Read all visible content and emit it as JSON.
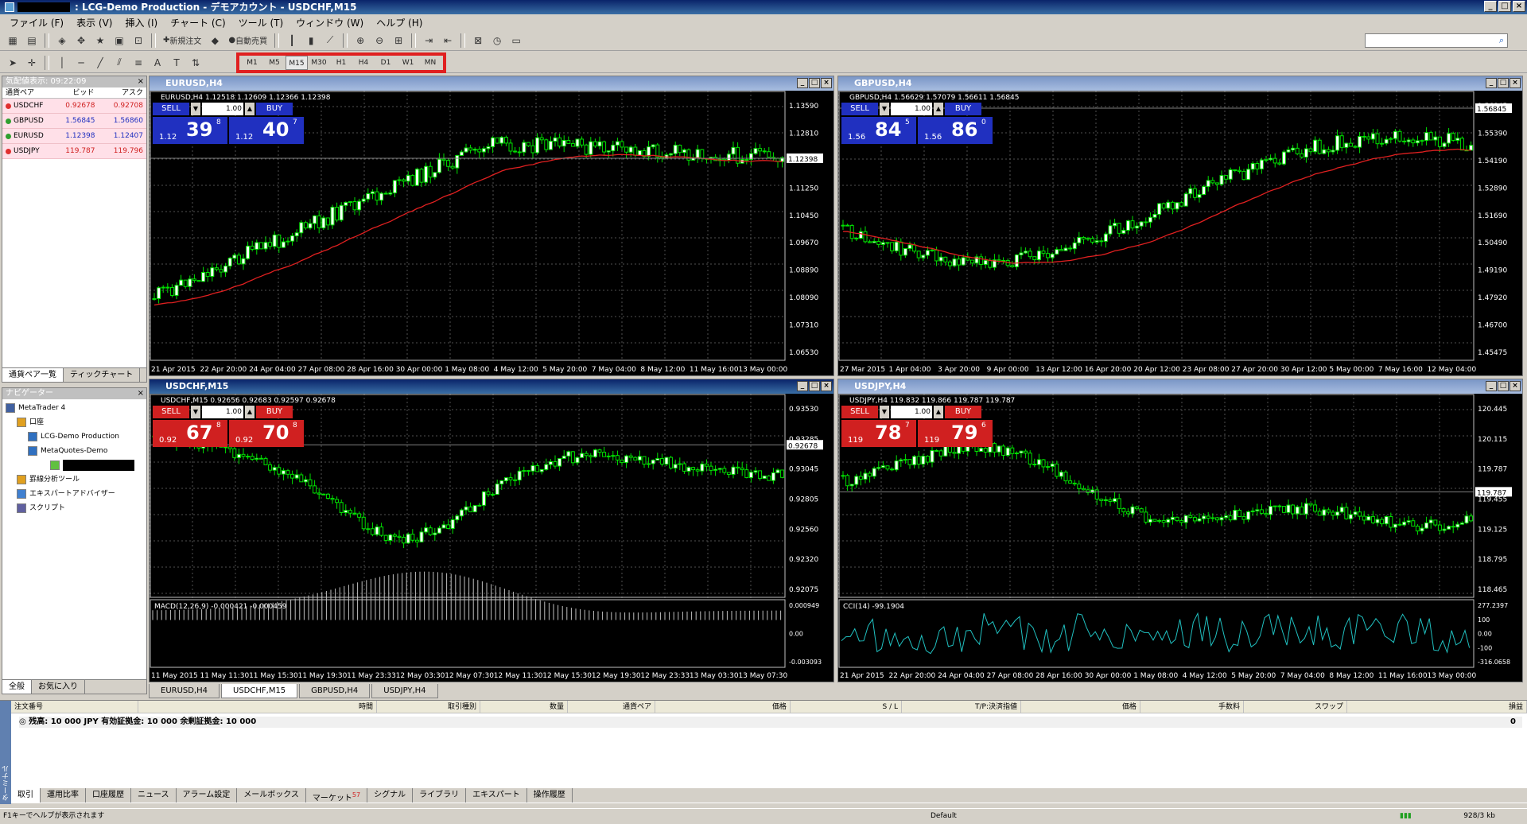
{
  "window": {
    "title": ": LCG-Demo Production - デモアカウント - USDCHF,M15"
  },
  "menu": [
    "ファイル (F)",
    "表示 (V)",
    "挿入 (I)",
    "チャート (C)",
    "ツール (T)",
    "ウィンドウ (W)",
    "ヘルプ (H)"
  ],
  "toolbar": {
    "new_order": "新規注文",
    "auto_trade": "自動売買"
  },
  "timeframes": [
    "M1",
    "M5",
    "M15",
    "M30",
    "H1",
    "H4",
    "D1",
    "W1",
    "MN"
  ],
  "active_timeframe": "M15",
  "market_watch": {
    "title": "気配値表示: 09:22:09",
    "headers": [
      "通貨ペア",
      "ビッド",
      "アスク"
    ],
    "rows": [
      {
        "symbol": "USDCHF",
        "bid": "0.92678",
        "ask": "0.92708",
        "color": "#e03030"
      },
      {
        "symbol": "GBPUSD",
        "bid": "1.56845",
        "ask": "1.56860",
        "color": "#30a030"
      },
      {
        "symbol": "EURUSD",
        "bid": "1.12398",
        "ask": "1.12407",
        "color": "#30a030"
      },
      {
        "symbol": "USDJPY",
        "bid": "119.787",
        "ask": "119.796",
        "color": "#e03030"
      }
    ],
    "tabs": [
      "通貨ペア一覧",
      "ティックチャート"
    ]
  },
  "navigator": {
    "title": "ナビゲーター",
    "items": [
      {
        "label": "MetaTrader 4",
        "level": 0
      },
      {
        "label": "口座",
        "level": 1
      },
      {
        "label": "LCG-Demo Production",
        "level": 2
      },
      {
        "label": "MetaQuotes-Demo",
        "level": 2
      },
      {
        "label": "罫線分析ツール",
        "level": 1
      },
      {
        "label": "エキスパートアドバイザー",
        "level": 1
      },
      {
        "label": "スクリプト",
        "level": 1
      }
    ],
    "tabs": [
      "全般",
      "お気に入り"
    ]
  },
  "charts": [
    {
      "id": "eurusd",
      "title": "EURUSD,H4",
      "header": "EURUSD,H4  1.12518 1.12609 1.12366 1.12398",
      "sell_big": "39",
      "sell_sup": "8",
      "sell_pre": "1.12",
      "buy_big": "40",
      "buy_sup": "7",
      "buy_pre": "1.12",
      "lot": "1.00",
      "panel_color": "#2030c0",
      "prices": [
        "1.13590",
        "1.12810",
        "1.12030",
        "1.11250",
        "1.10450",
        "1.09670",
        "1.08890",
        "1.08090",
        "1.07310",
        "1.06530"
      ],
      "current": "1.12398",
      "dates": [
        "21 Apr 2015",
        "22 Apr 20:00",
        "24 Apr 04:00",
        "27 Apr 08:00",
        "28 Apr 16:00",
        "30 Apr 00:00",
        "1 May 08:00",
        "4 May 12:00",
        "5 May 20:00",
        "7 May 04:00",
        "8 May 12:00",
        "11 May 16:00",
        "13 May 00:00"
      ],
      "active": false,
      "sub": null
    },
    {
      "id": "gbpusd",
      "title": "GBPUSD,H4",
      "header": "GBPUSD,H4  1.56629 1.57079 1.56611 1.56845",
      "sell_big": "84",
      "sell_sup": "5",
      "sell_pre": "1.56",
      "buy_big": "86",
      "buy_sup": "0",
      "buy_pre": "1.56",
      "lot": "1.00",
      "panel_color": "#2030c0",
      "prices": [
        "1.56845",
        "1.55390",
        "1.54190",
        "1.52890",
        "1.51690",
        "1.50490",
        "1.49190",
        "1.47920",
        "1.46700",
        "1.45475"
      ],
      "current": "1.56845",
      "dates": [
        "27 Mar 2015",
        "1 Apr 04:00",
        "3 Apr 20:00",
        "9 Apr 00:00",
        "13 Apr 12:00",
        "16 Apr 20:00",
        "20 Apr 12:00",
        "23 Apr 08:00",
        "27 Apr 20:00",
        "30 Apr 12:00",
        "5 May 00:00",
        "7 May 16:00",
        "12 May 04:00"
      ],
      "active": false,
      "sub": null
    },
    {
      "id": "usdchf",
      "title": "USDCHF,M15",
      "header": "USDCHF,M15  0.92656 0.92683 0.92597 0.92678",
      "sell_big": "67",
      "sell_sup": "8",
      "sell_pre": "0.92",
      "buy_big": "70",
      "buy_sup": "8",
      "buy_pre": "0.92",
      "lot": "1.00",
      "panel_color": "#d02020",
      "prices": [
        "0.93530",
        "0.93285",
        "0.93045",
        "0.92805",
        "0.92560",
        "0.92320",
        "0.92075"
      ],
      "current": "0.92678",
      "dates": [
        "11 May 2015",
        "11 May 11:30",
        "11 May 15:30",
        "11 May 19:30",
        "11 May 23:33",
        "12 May 03:30",
        "12 May 07:30",
        "12 May 11:30",
        "12 May 15:30",
        "12 May 19:30",
        "12 May 23:33",
        "13 May 03:30",
        "13 May 07:30"
      ],
      "active": true,
      "sub": {
        "label": "MACD(12,26,9) -0.000421 -0.000459",
        "ticks": [
          "0.000949",
          "0.00",
          "-0.003093"
        ]
      }
    },
    {
      "id": "usdjpy",
      "title": "USDJPY,H4",
      "header": "USDJPY,H4  119.832 119.866 119.787 119.787",
      "sell_big": "78",
      "sell_sup": "7",
      "sell_pre": "119",
      "buy_big": "79",
      "buy_sup": "6",
      "buy_pre": "119",
      "lot": "1.00",
      "panel_color": "#d02020",
      "prices": [
        "120.445",
        "120.115",
        "119.787",
        "119.455",
        "119.125",
        "118.795",
        "118.465"
      ],
      "current": "119.787",
      "dates": [
        "21 Apr 2015",
        "22 Apr 20:00",
        "24 Apr 04:00",
        "27 Apr 08:00",
        "28 Apr 16:00",
        "30 Apr 00:00",
        "1 May 08:00",
        "4 May 12:00",
        "5 May 20:00",
        "7 May 04:00",
        "8 May 12:00",
        "11 May 16:00",
        "13 May 00:00"
      ],
      "active": false,
      "sub": {
        "label": "CCI(14) -99.1904",
        "ticks": [
          "277.2397",
          "100",
          "0.00",
          "-100",
          "-316.0658"
        ]
      }
    }
  ],
  "chart_tabs": [
    "EURUSD,H4",
    "USDCHF,M15",
    "GBPUSD,H4",
    "USDJPY,H4"
  ],
  "active_chart_tab": "USDCHF,M15",
  "terminal": {
    "columns": [
      "注文番号",
      "時間",
      "取引種別",
      "数量",
      "通貨ペア",
      "価格",
      "S / L",
      "T/P:決済指値",
      "価格",
      "手数料",
      "スワップ",
      "損益"
    ],
    "balance": "残高: 10 000 JPY  有効証拠金: 10 000  余剰証拠金: 10 000",
    "balance_value": "0",
    "tabs": [
      "取引",
      "運用比率",
      "口座履歴",
      "ニュース",
      "アラーム設定",
      "メールボックス",
      "マーケット",
      "シグナル",
      "ライブラリ",
      "エキスパート",
      "操作履歴"
    ],
    "market_badge": "57",
    "side_label": "ターミナル"
  },
  "status": {
    "help": "F1キーでヘルプが表示されます",
    "profile": "Default",
    "traffic": "928/3 kb"
  }
}
